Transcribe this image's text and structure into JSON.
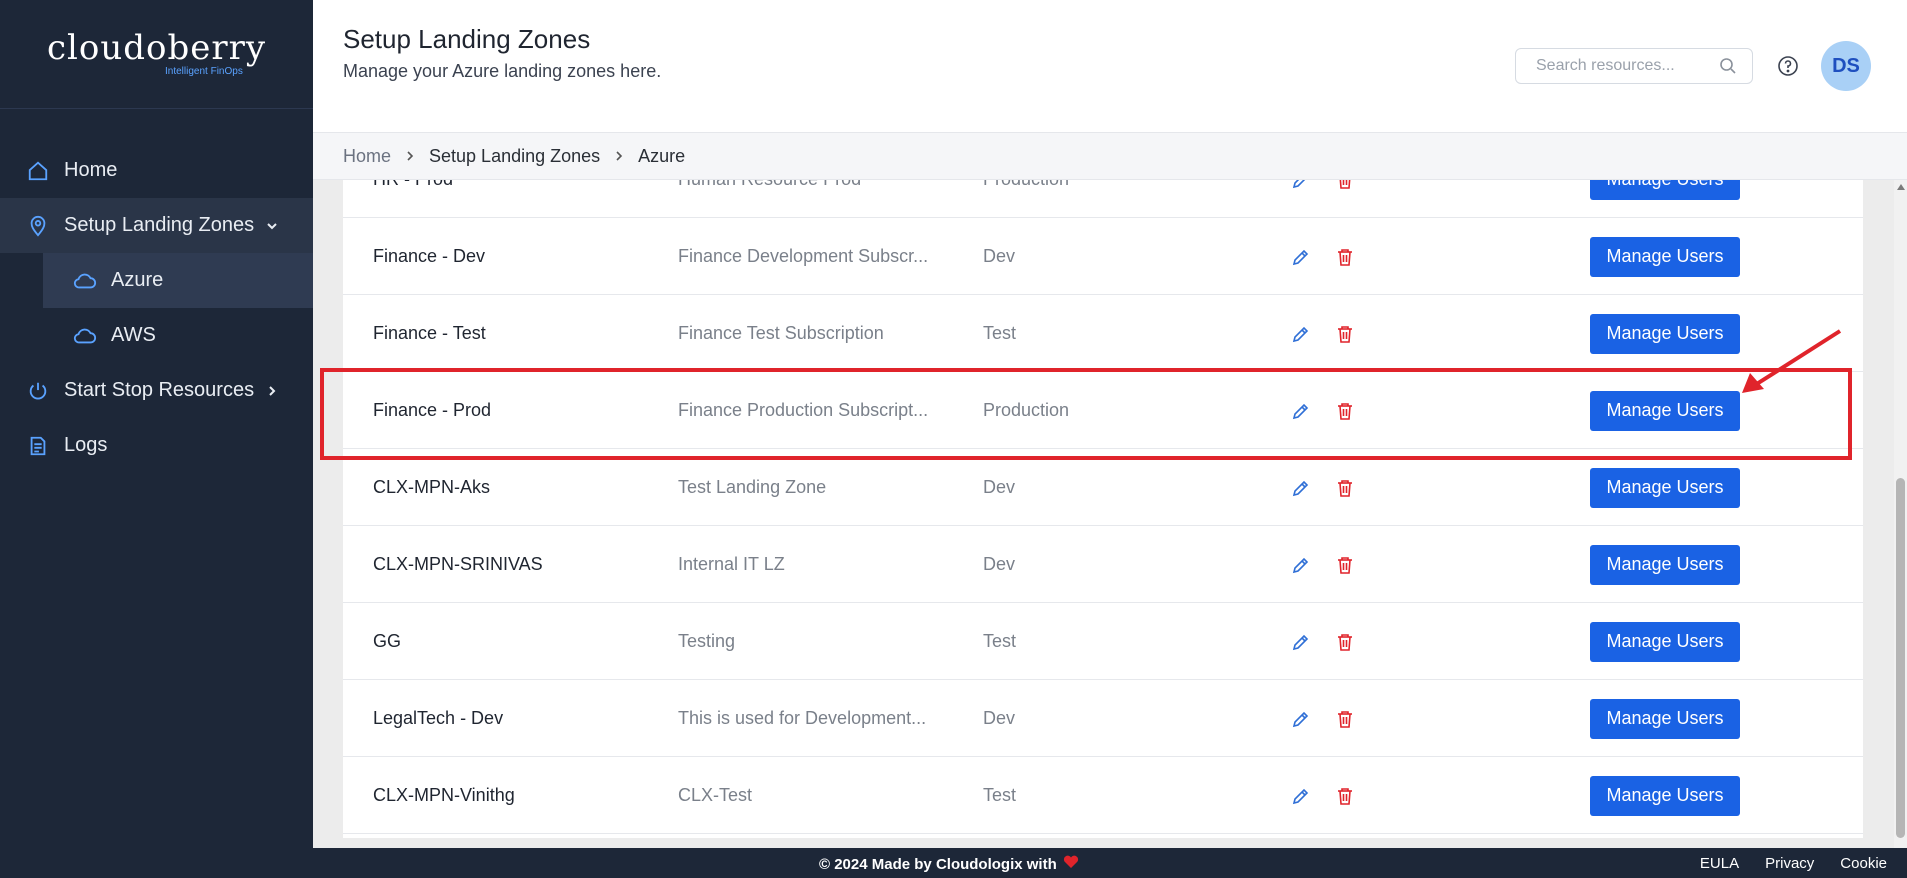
{
  "brand": {
    "name": "cloudoberry",
    "tagline": "Intelligent FinOps"
  },
  "sidebar": {
    "items": [
      {
        "label": "Home",
        "icon": "home-icon"
      },
      {
        "label": "Setup Landing Zones",
        "icon": "location-pin-icon",
        "expanded": true
      },
      {
        "label": "Azure",
        "icon": "cloud-icon",
        "selected": true
      },
      {
        "label": "AWS",
        "icon": "cloud-icon"
      },
      {
        "label": "Start Stop Resources",
        "icon": "power-icon"
      },
      {
        "label": "Logs",
        "icon": "document-list-icon"
      }
    ]
  },
  "header": {
    "title": "Setup Landing Zones",
    "subtitle": "Manage your Azure landing zones here.",
    "search_placeholder": "Search resources...",
    "avatar_initials": "DS"
  },
  "breadcrumb": [
    "Home",
    "Setup Landing Zones",
    "Azure"
  ],
  "table": {
    "button_label": "Manage Users",
    "rows": [
      {
        "name": "HR - Prod",
        "description": "Human Resource Prod",
        "environment": "Production"
      },
      {
        "name": "Finance - Dev",
        "description": "Finance Development Subscr...",
        "environment": "Dev"
      },
      {
        "name": "Finance - Test",
        "description": "Finance Test Subscription",
        "environment": "Test"
      },
      {
        "name": "Finance - Prod",
        "description": "Finance Production Subscript...",
        "environment": "Production"
      },
      {
        "name": "CLX-MPN-Aks",
        "description": "Test Landing Zone",
        "environment": "Dev"
      },
      {
        "name": "CLX-MPN-SRINIVAS",
        "description": "Internal IT LZ",
        "environment": "Dev"
      },
      {
        "name": "GG",
        "description": "Testing",
        "environment": "Test"
      },
      {
        "name": "LegalTech - Dev",
        "description": "This is used for Development...",
        "environment": "Dev"
      },
      {
        "name": "CLX-MPN-Vinithg",
        "description": "CLX-Test",
        "environment": "Test"
      }
    ]
  },
  "footer": {
    "copyright": "© 2024 Made by Cloudologix with",
    "links": [
      "EULA",
      "Privacy",
      "Cookie"
    ]
  },
  "colors": {
    "sidebar_bg": "#1d2738",
    "accent_blue": "#1a62e4",
    "edit_icon": "#2f6fd6",
    "delete_icon": "#e0242b",
    "highlight_red": "#e0242b"
  }
}
